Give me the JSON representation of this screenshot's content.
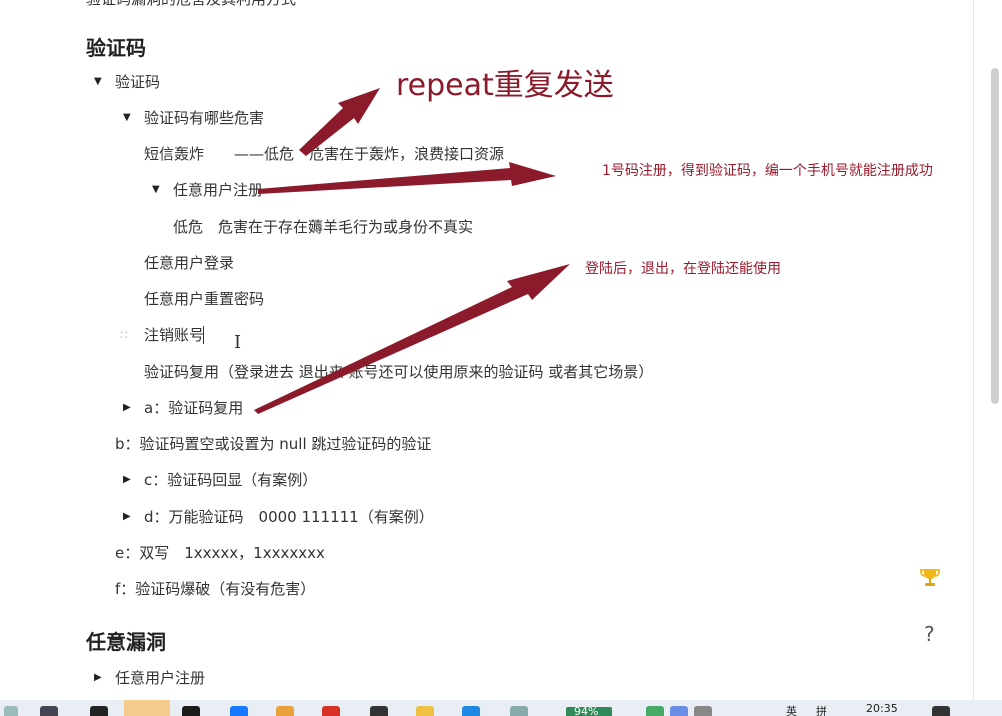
{
  "partial_top_line": "验证码漏洞的危害及其利用方式",
  "sections": [
    {
      "heading": "验证码",
      "rows": [
        {
          "text": "验证码",
          "marker": "down"
        },
        {
          "text": "验证码有哪些危害",
          "marker": "down"
        },
        {
          "text": "短信轰炸　　——低危　危害在于轰炸，浪费接口资源",
          "marker": ""
        },
        {
          "text": "任意用户注册",
          "marker": "down"
        },
        {
          "text": "低危　危害在于存在薅羊毛行为或身份不真实",
          "marker": ""
        },
        {
          "text": "任意用户登录",
          "marker": ""
        },
        {
          "text": "任意用户重置密码",
          "marker": ""
        },
        {
          "text": "注销账号",
          "marker": "drag"
        },
        {
          "text": "验证码复用（登录进去 退出来 账号还可以使用原来的验证码 或者其它场景）",
          "marker": ""
        },
        {
          "text": "a：验证码复用",
          "marker": "right"
        },
        {
          "text": "b：验证码置空或设置为 null  跳过验证码的验证",
          "marker": ""
        },
        {
          "text": "c：验证码回显（有案例）",
          "marker": "right"
        },
        {
          "text": "d：万能验证码　0000  111111（有案例）",
          "marker": "right"
        },
        {
          "text": "e：双写　1xxxxx，1xxxxxxx",
          "marker": ""
        },
        {
          "text": "f：验证码爆破（有没有危害）",
          "marker": ""
        }
      ]
    },
    {
      "heading": "任意漏洞",
      "rows": [
        {
          "text": "任意用户注册",
          "marker": "right"
        }
      ]
    }
  ],
  "annotations": {
    "repeat": "repeat重复发送",
    "register": "1号码注册，得到验证码，编一个手机号就能注册成功",
    "login": "登陆后，退出，在登陆还能使用"
  },
  "annotation_color": "#8b1a2b",
  "help_symbol": "?",
  "taskbar": {
    "battery": "94%",
    "ime_lang": "英",
    "ime_mode": "拼",
    "clock": "20:35"
  }
}
